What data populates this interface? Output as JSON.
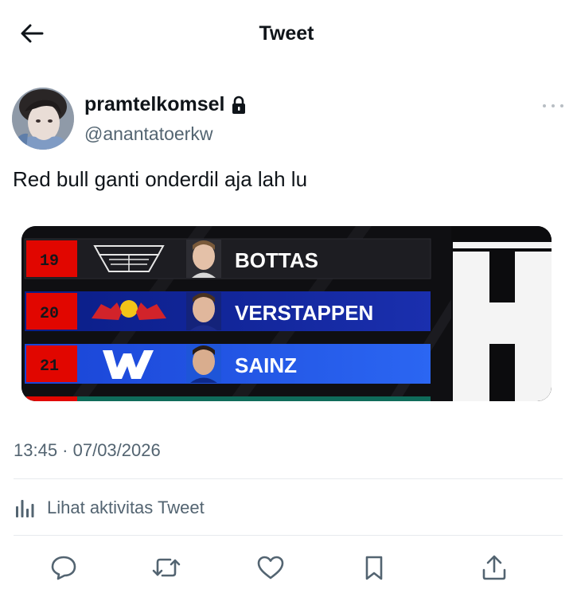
{
  "header": {
    "title": "Tweet",
    "back_icon": "arrow-left-icon"
  },
  "author": {
    "display_name": "pramtelkomsel",
    "handle": "@anantatoerkw",
    "locked_icon": "lock-icon",
    "avatar": "user-avatar"
  },
  "tweet": {
    "text": "Red bull ganti onderdil aja lah lu"
  },
  "media": {
    "rows": [
      {
        "position": "19",
        "driver": "BOTTAS",
        "team_logo": "cadillac-logo"
      },
      {
        "position": "20",
        "driver": "VERSTAPPEN",
        "team_logo": "red-bull-logo"
      },
      {
        "position": "21",
        "driver": "SAINZ",
        "team_logo": "williams-logo"
      }
    ]
  },
  "meta": {
    "timestamp": "13:45 · 07/03/2026"
  },
  "activity": {
    "label": "Lihat aktivitas Tweet",
    "icon": "analytics-icon"
  },
  "actions": [
    {
      "name": "reply",
      "icon": "comment-icon"
    },
    {
      "name": "retweet",
      "icon": "retweet-icon"
    },
    {
      "name": "like",
      "icon": "heart-icon"
    },
    {
      "name": "bookmark",
      "icon": "bookmark-icon"
    },
    {
      "name": "share",
      "icon": "share-icon"
    }
  ],
  "colors": {
    "text": "#0f1419",
    "secondary": "#536471",
    "divider": "#e7eaed"
  }
}
